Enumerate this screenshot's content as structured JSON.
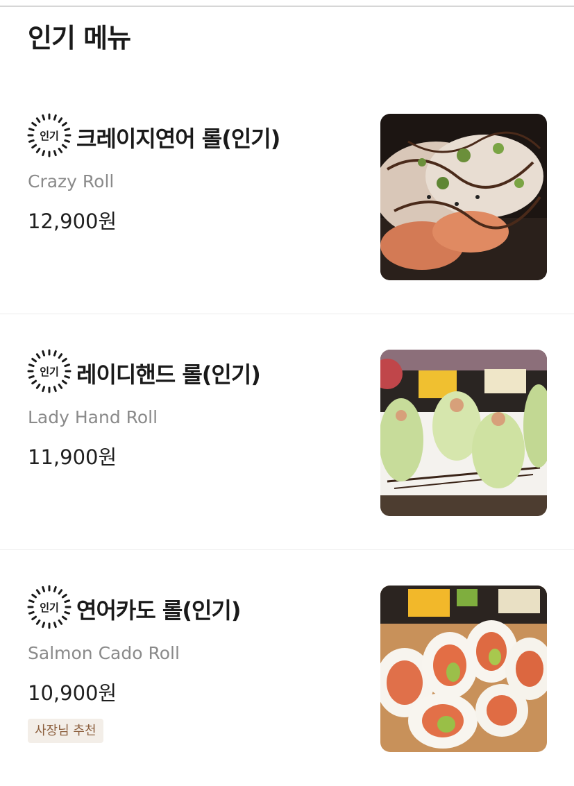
{
  "section": {
    "title": "인기 메뉴"
  },
  "badge": {
    "label": "인기",
    "icon": "popular-burst-icon"
  },
  "items": [
    {
      "name": "크레이지연어 롤(인기)",
      "description": "Crazy Roll",
      "price": "12,900원",
      "image": "crazy-roll-photo"
    },
    {
      "name": "레이디핸드 롤(인기)",
      "description": "Lady Hand Roll",
      "price": "11,900원",
      "image": "lady-hand-roll-photo"
    },
    {
      "name": "연어카도 롤(인기)",
      "description": "Salmon Cado Roll",
      "price": "10,900원",
      "tag": "사장님 추천",
      "image": "salmon-cado-roll-photo"
    }
  ],
  "colors": {
    "title_text": "#1a1a1a",
    "description_text": "#8a8a8a",
    "tag_text": "#8b5e3c",
    "tag_background": "#f3eee8",
    "divider": "#ececec"
  }
}
